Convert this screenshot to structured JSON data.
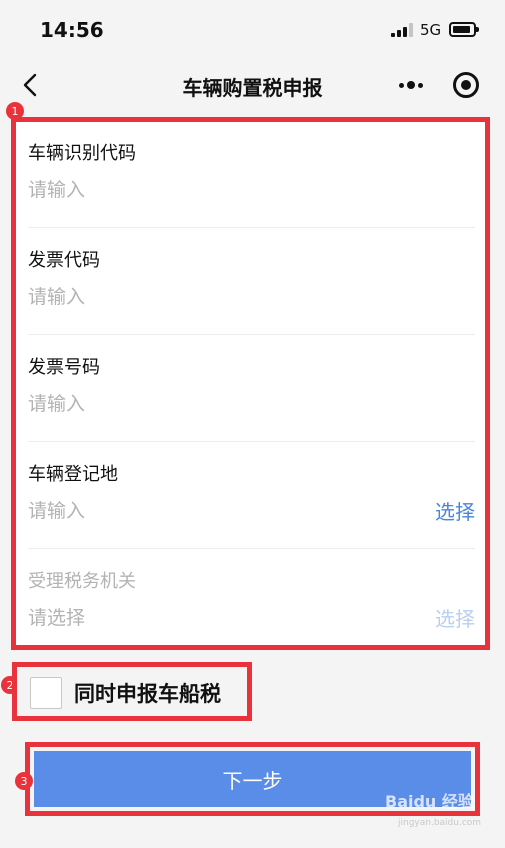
{
  "status_bar": {
    "time": "14:56",
    "network": "5G"
  },
  "nav": {
    "title": "车辆购置税申报"
  },
  "form": {
    "fields": [
      {
        "label": "车辆识别代码",
        "placeholder": "请输入",
        "action": ""
      },
      {
        "label": "发票代码",
        "placeholder": "请输入",
        "action": ""
      },
      {
        "label": "发票号码",
        "placeholder": "请输入",
        "action": ""
      },
      {
        "label": "车辆登记地",
        "placeholder": "请输入",
        "action": "选择"
      },
      {
        "label": "受理税务机关",
        "placeholder": "请选择",
        "action": "选择"
      }
    ]
  },
  "checkbox": {
    "label": "同时申报车船税"
  },
  "next_button": {
    "label": "下一步"
  },
  "markers": [
    "1",
    "2",
    "3"
  ],
  "watermark": {
    "text": "Baidu 经验",
    "sub": "jingyan.baidu.com"
  },
  "colors": {
    "accent": "#5a8de8",
    "link": "#4a86d9",
    "annotation": "#e8333c"
  }
}
